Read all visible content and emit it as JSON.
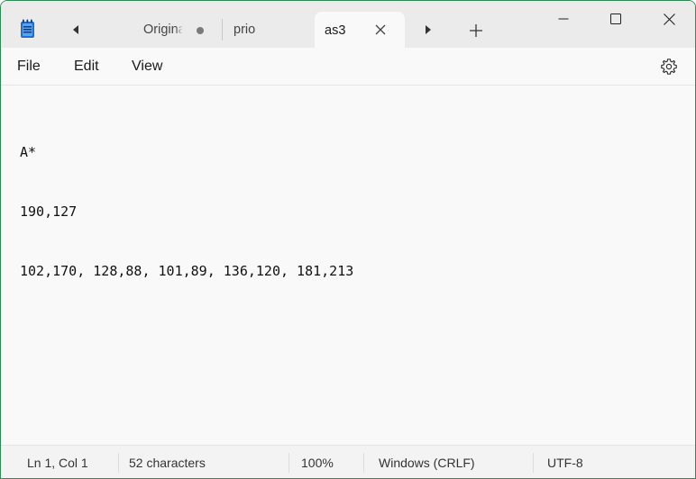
{
  "tabs": [
    {
      "label": "Original",
      "modified": true
    },
    {
      "label": "prio",
      "modified": false
    },
    {
      "label": "as3",
      "active": true
    }
  ],
  "menu": {
    "file": "File",
    "edit": "Edit",
    "view": "View"
  },
  "editor": {
    "lines": [
      "A*",
      "190,127",
      "102,170, 128,88, 101,89, 136,120, 181,213"
    ]
  },
  "status": {
    "position": "Ln 1, Col 1",
    "characters": "52 characters",
    "zoom": "100%",
    "line_ending": "Windows (CRLF)",
    "encoding": "UTF-8"
  },
  "icons": {
    "app": "notepad-icon",
    "settings": "gear-icon"
  },
  "colors": {
    "window_border": "#2e8b57",
    "tab_bar": "#ebebeb",
    "active_tab": "#f9f9f9",
    "notepad_icon": "#1e6fd0"
  }
}
